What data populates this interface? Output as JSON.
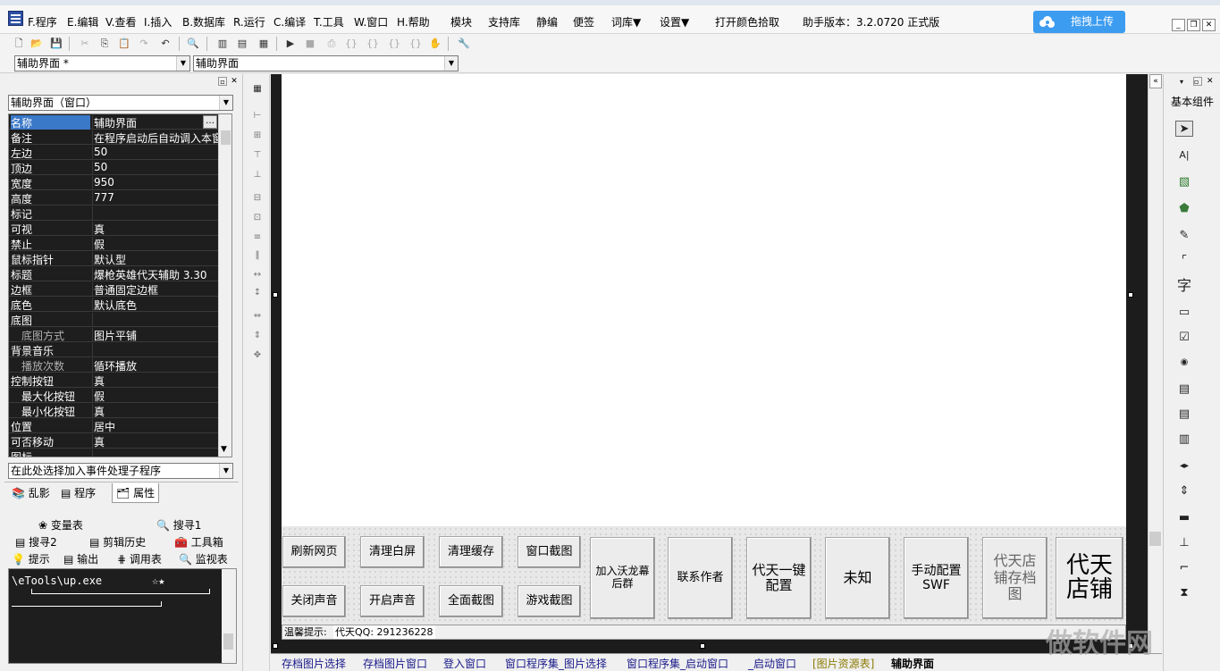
{
  "menu": {
    "items": [
      "F.程序",
      "E.编辑",
      "V.查看",
      "I.插入",
      "B.数据库",
      "R.运行",
      "C.编译",
      "T.工具",
      "W.窗口",
      "H.帮助",
      "模块",
      "支持库",
      "静编",
      "便签",
      "词库▼",
      "设置▼",
      "打开颜色拾取"
    ],
    "version_label": "助手版本：3.2.0720 正式版",
    "upload_label": "拖拽上传"
  },
  "combos": {
    "left_value": "辅助界面 *",
    "right_value": "辅助界面"
  },
  "left_panel": {
    "object_selector": "辅助界面（窗口）",
    "properties": [
      {
        "k": "名称",
        "v": "辅助界面"
      },
      {
        "k": "备注",
        "v": "在程序启动后自动调入本窗"
      },
      {
        "k": "左边",
        "v": "50"
      },
      {
        "k": "顶边",
        "v": "50"
      },
      {
        "k": "宽度",
        "v": "950"
      },
      {
        "k": "高度",
        "v": "777"
      },
      {
        "k": "标记",
        "v": ""
      },
      {
        "k": "可视",
        "v": "真"
      },
      {
        "k": "禁止",
        "v": "假"
      },
      {
        "k": "鼠标指针",
        "v": "默认型"
      },
      {
        "k": "标题",
        "v": "爆枪英雄代天辅助    3.30"
      },
      {
        "k": "边框",
        "v": "普通固定边框"
      },
      {
        "k": "底色",
        "v": "默认底色"
      },
      {
        "k": "底图",
        "v": ""
      },
      {
        "k": "底图方式",
        "v": "图片平铺",
        "sub": true
      },
      {
        "k": "背景音乐",
        "v": ""
      },
      {
        "k": "播放次数",
        "v": "循环播放",
        "sub": true
      },
      {
        "k": "控制按钮",
        "v": "真"
      },
      {
        "k": "最大化按钮",
        "v": "假",
        "sub2": true
      },
      {
        "k": "最小化按钮",
        "v": "真",
        "sub2": true
      },
      {
        "k": "位置",
        "v": "居中"
      },
      {
        "k": "可否移动",
        "v": "真"
      },
      {
        "k": "图标",
        "v": ""
      }
    ],
    "event_selector": "在此处选择加入事件处理子程序",
    "tabs_top": [
      "乱影",
      "程序",
      "属性"
    ],
    "tabs_mid": [
      "变量表",
      "搜寻1",
      "搜寻2",
      "剪辑历史",
      "工具箱",
      "提示",
      "输出",
      "调用表",
      "监视表"
    ],
    "output_text": "\\eTools\\up.exe"
  },
  "design": {
    "buttons": [
      {
        "label": "刷新网页"
      },
      {
        "label": "清理白屏"
      },
      {
        "label": "清理缓存"
      },
      {
        "label": "窗口截图"
      },
      {
        "label": "关闭声音"
      },
      {
        "label": "开启声音"
      },
      {
        "label": "全面截图"
      },
      {
        "label": "游戏截图"
      },
      {
        "label": "加入沃龙幕后群"
      },
      {
        "label": "联系作者"
      },
      {
        "label": "代天一键配置"
      },
      {
        "label": "未知"
      },
      {
        "label": "手动配置SWF"
      },
      {
        "label": "代天店铺存档图"
      },
      {
        "label": "代天店铺"
      }
    ],
    "tip_label": "温馨提示:",
    "tip_value": "代天QQ: 291236228"
  },
  "bottom_tabs": [
    "存档图片选择",
    "存档图片窗口",
    "登入窗口",
    "窗口程序集_图片选择",
    "窗口程序集_启动窗口",
    "_启动窗口",
    "[图片资源表]",
    "辅助界面"
  ],
  "right_panel": {
    "title": "基本组件"
  },
  "watermark": "做软件网"
}
